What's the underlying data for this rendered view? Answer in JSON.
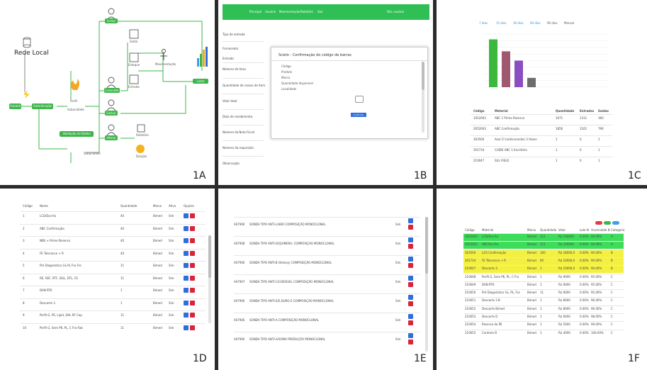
{
  "labels": {
    "a": "1A",
    "b": "1B",
    "c": "1C",
    "d": "1D",
    "e": "1E",
    "f": "1F"
  },
  "p1a": {
    "rede_local": "Rede Local",
    "perfil": "Perfil",
    "subunidade": "Subunidade",
    "subunidade2": "Subunidade",
    "usuario": "Usuário",
    "nodes": [
      "Usuário",
      "Autenticação",
      "Validação de Dados",
      "Incluir",
      "Consultar",
      "Excluir",
      "Alterar",
      "Listar"
    ],
    "icons": [
      "Saída",
      "Estoque",
      "Entrada",
      "Movimentação",
      "Relatórios",
      "Relatório",
      "Doação"
    ]
  },
  "p1b": {
    "nav": [
      "Principal",
      "Usuário",
      "Movimentação",
      "Relatório",
      "Sair"
    ],
    "nav_right": "Olá, usuário",
    "side": [
      "Tipo de entrada",
      "Fornecedor",
      "Entrada",
      "Número de itens",
      "Quantidade de caixas de item",
      "Valor total",
      "Data do recebimento",
      "Número da Nota Fiscal",
      "Número da requisição",
      "Observação"
    ],
    "modal_title": "Scielo - Confirmação do código de barras",
    "modal_fields": [
      "Código",
      "Produto",
      "Marca",
      "Quantidade disponível",
      "Localidade"
    ],
    "modal_btn": "Confirmar"
  },
  "p1c": {
    "filters": [
      "7 dias",
      "15 dias",
      "30 dias",
      "60 dias",
      "90 dias",
      "Mensal"
    ],
    "header": [
      "Código",
      "Material",
      "Quantidade",
      "Entradas",
      "Saídas"
    ],
    "rows": [
      [
        "1052003",
        "ABC 1 Prime Reserva",
        "1671",
        "1311",
        "360"
      ],
      [
        "2052003",
        "ABC Confirmação",
        "1856",
        "1161",
        "796"
      ],
      [
        "303500",
        "Azul Cl (anticorrosão) 3 Vezes",
        "1",
        "0",
        "1"
      ],
      [
        "301734",
        "CUIDE ABC 1 Escritório",
        "1",
        "0",
        "1"
      ],
      [
        "210047",
        "SUL FIELD",
        "1",
        "0",
        "1"
      ]
    ]
  },
  "chart_data": {
    "type": "bar",
    "categories": [
      "1",
      "2",
      "3",
      "4"
    ],
    "values": [
      72,
      54,
      40,
      14
    ],
    "colors": [
      "#3cb83c",
      "#a05a70",
      "#8a4dc2",
      "#6d6d6d"
    ]
  },
  "p1d": {
    "header": [
      "Código",
      "Nome",
      "Quantidade",
      "Marca",
      "Ativo",
      "Opções"
    ],
    "rows": [
      [
        "1",
        "LCD/Escrita",
        "40",
        "Bimed",
        "Sim"
      ],
      [
        "2",
        "ABC Confirmação",
        "40",
        "Bimed",
        "Sim"
      ],
      [
        "3",
        "NBS + Prime Reserva",
        "40",
        "Bimed",
        "Sim"
      ],
      [
        "4",
        "FE Tolerance + R",
        "40",
        "Bimed",
        "Sim"
      ],
      [
        "5",
        "Pré Diagnóstico GL-PL Fra-Fre",
        "11",
        "Bimed",
        "Sim"
      ],
      [
        "6",
        "RE, REF, RTF, DGL, DTL, FE",
        "11",
        "Bimed",
        "Sim"
      ],
      [
        "7",
        "DAN RTK",
        "1",
        "Bimed",
        "Sim"
      ],
      [
        "8",
        "Descarte 3",
        "1",
        "Bimed",
        "Sim"
      ],
      [
        "9",
        "Perfil G, PE, Lipid, DAL RF Cap",
        "11",
        "Bimed",
        "Sim"
      ],
      [
        "10",
        "Perfil G, Sere PK, PL, C Fra-Fab",
        "11",
        "Bimed",
        "Sim"
      ]
    ]
  },
  "p1e": {
    "rows": [
      [
        "A07906",
        "SONDA TIPO ANTI-LABIO COMPOSIÇÃO MONOCLONAL",
        "Sim"
      ],
      [
        "A07908",
        "SONDA TIPO ANTI-D/QUIMERA, COMPOSIÇÃO MONOCLONAL",
        "Sim"
      ],
      [
        "A07906",
        "SONDA TIPO ANTI-B (Kidney) COMPOSIÇÃO MONOCLONAL",
        "Sim"
      ],
      [
        "A07907",
        "SONDA TIPO ANTI-C/COESIVEL COMPOSIÇÃO MONOCLONAL",
        "Sim"
      ],
      [
        "A07906",
        "SONDA TIPO ANTI-E/E,DURO E COMPOSIÇÃO MONOCLONAL",
        "Sim"
      ],
      [
        "A07906",
        "SONDA TIPO ANTI-A COMPOSIÇÃO MONOCLONAL",
        "Sim"
      ],
      [
        "A07906",
        "SONDA TIPO ANTI-A/SOMA PRODUÇÃO MONOCLONAL",
        "Sim"
      ]
    ]
  },
  "p1f": {
    "header": [
      "Código",
      "Material",
      "Marca",
      "Quantidade",
      "Valor",
      "Lote N",
      "Acumulado N",
      "Categoria"
    ],
    "rows": [
      [
        "1052003",
        "LCD/Escrita",
        "Bimed",
        "111",
        "R$ 100000",
        "0.00%",
        "60.00%",
        "A",
        "green"
      ],
      [
        "2052003",
        "ABC/Escrita",
        "Bimed",
        "111",
        "R$ 100000",
        "0.00%",
        "60.00%",
        "A",
        "green"
      ],
      [
        "303500",
        "LGS Confirmação",
        "Bimed",
        "160",
        "R$ 18000,0",
        "0.00%",
        "90.00%",
        "B",
        "yellow"
      ],
      [
        "301734",
        "FE Tolerance + R",
        "Bimed",
        "60",
        "R$ 10000,0",
        "0.00%",
        "90.00%",
        "B",
        "yellow"
      ],
      [
        "210047",
        "Descarte 3",
        "Bimed",
        "1",
        "R$ 10000,0",
        "0.00%",
        "90.00%",
        "B",
        "yellow"
      ],
      [
        "210048",
        "Perfil G, Sere PK, PL, C Fra",
        "Bimed",
        "1",
        "R$ 9000",
        "0.00%",
        "95.00%",
        "C",
        "white"
      ],
      [
        "210049",
        "DAN RTK",
        "Bimed",
        "1",
        "R$ 9000",
        "0.00%",
        "95.00%",
        "C",
        "white"
      ],
      [
        "210050",
        "Pré Diagnóstico GL, PL, Fra",
        "Bimed",
        "11",
        "R$ 9000",
        "0.00%",
        "95.00%",
        "C",
        "white"
      ],
      [
        "210051",
        "Descarte 3 B",
        "Bimed",
        "1",
        "R$ 8000",
        "0.00%",
        "96.00%",
        "C",
        "white"
      ],
      [
        "210052",
        "Descarte Bimed",
        "Bimed",
        "1",
        "R$ 8000",
        "0.00%",
        "96.00%",
        "C",
        "white"
      ],
      [
        "210053",
        "Descarte D",
        "Bimed",
        "1",
        "R$ 6000",
        "0.00%",
        "98.00%",
        "C",
        "white"
      ],
      [
        "210054",
        "Reserva do PE",
        "Bimed",
        "1",
        "R$ 5000",
        "0.00%",
        "99.00%",
        "C",
        "white"
      ],
      [
        "210055",
        "Controle B",
        "Bimed",
        "1",
        "R$ 4000",
        "0.00%",
        "100.00%",
        "C",
        "white"
      ]
    ]
  }
}
